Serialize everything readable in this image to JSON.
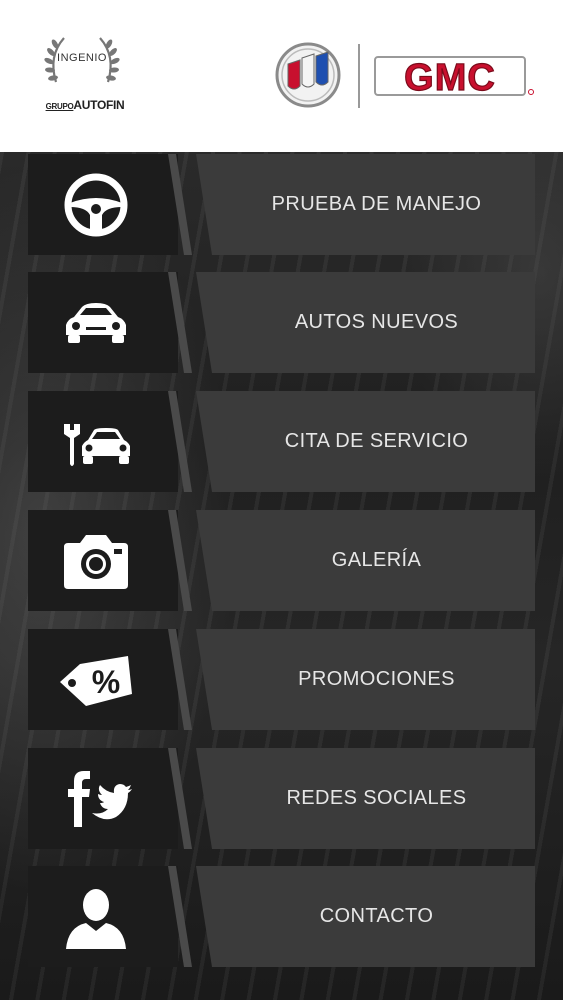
{
  "header": {
    "ingenio_text": "INGENIO",
    "grupo_text_small": "GRUPO",
    "grupo_text": "AUTOFIN",
    "gmc_text": "GMC"
  },
  "menu": [
    {
      "label": "PRUEBA DE MANEJO",
      "icon": "steering-wheel-icon"
    },
    {
      "label": "AUTOS NUEVOS",
      "icon": "car-icon"
    },
    {
      "label": "CITA DE SERVICIO",
      "icon": "car-service-icon"
    },
    {
      "label": "GALERÍA",
      "icon": "camera-icon"
    },
    {
      "label": "PROMOCIONES",
      "icon": "percent-tag-icon"
    },
    {
      "label": "REDES SOCIALES",
      "icon": "facebook-twitter-icon"
    },
    {
      "label": "CONTACTO",
      "icon": "person-icon"
    }
  ],
  "colors": {
    "gmc_red": "#c8102e",
    "label_bg": "#3b3b3b",
    "icon_bg": "#1c1c1c",
    "text": "#e6e6e6"
  }
}
